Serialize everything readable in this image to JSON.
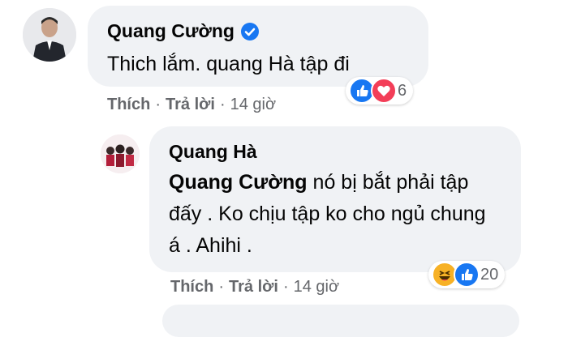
{
  "comments": [
    {
      "author": "Quang Cường",
      "verified_icon": "verified-badge-icon",
      "text": "Thich lắm. quang Hà tập đi",
      "reactions": {
        "icons": [
          "like-icon",
          "love-icon"
        ],
        "count": "6"
      },
      "actions": {
        "like": "Thích",
        "reply": "Trả lời",
        "time": "14 giờ"
      }
    },
    {
      "author": "Quang Hà",
      "mention": "Quang Cường",
      "text": " nó bị bắt phải tập đấy . Ko chịu tập ko cho ngủ chung á . Ahihi .",
      "reactions": {
        "icons": [
          "haha-icon",
          "like-icon"
        ],
        "count": "20"
      },
      "actions": {
        "like": "Thích",
        "reply": "Trả lời",
        "time": "14 giờ"
      }
    }
  ],
  "colors": {
    "bubble": "#f0f2f5",
    "meta_text": "#65676b",
    "like_blue": "#1877f2",
    "love_red": "#f33e58",
    "haha_yellow": "#f7b125"
  }
}
